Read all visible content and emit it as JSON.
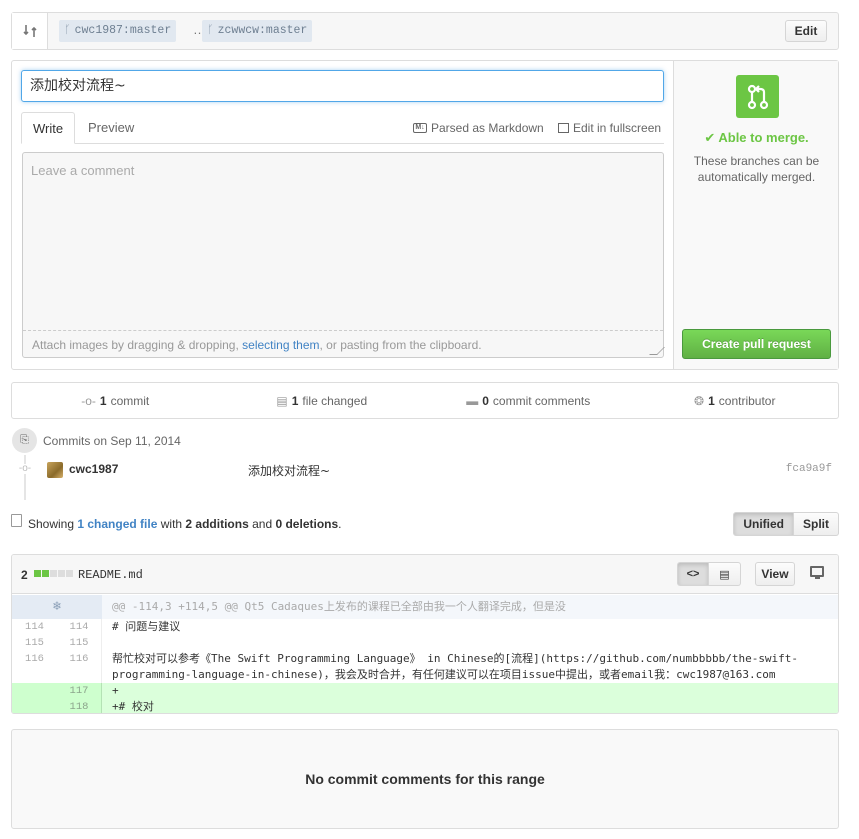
{
  "range": {
    "base": "cwc1987:master",
    "separator": "…",
    "head": "zcwwcw:master",
    "edit_label": "Edit"
  },
  "compose": {
    "title_value": "添加校对流程~",
    "tab_write": "Write",
    "tab_preview": "Preview",
    "parsed_markdown": "Parsed as Markdown",
    "edit_fullscreen": "Edit in fullscreen",
    "comment_placeholder": "Leave a comment",
    "attach_prefix": "Attach images by dragging & dropping, ",
    "attach_link": "selecting them",
    "attach_suffix": ", or pasting from the clipboard."
  },
  "merge": {
    "status": "Able to merge.",
    "description": "These branches can be automatically merged.",
    "create_label": "Create pull request",
    "accent": "#6cc644"
  },
  "numbers": {
    "commits_count": "1",
    "commits_label": "commit",
    "files_count": "1",
    "files_label": "file changed",
    "comments_count": "0",
    "comments_label": "commit comments",
    "contributors_count": "1",
    "contributors_label": "contributor"
  },
  "commits": {
    "date_label": "Commits on Sep 11, 2014",
    "items": [
      {
        "author": "cwc1987",
        "message": "添加校对流程~",
        "sha": "fca9a9f"
      }
    ]
  },
  "toc": {
    "prefix": "Showing ",
    "changed_link": "1 changed file",
    "with": " with ",
    "additions": "2 additions",
    "and": " and ",
    "deletions": "0 deletions",
    "period": ".",
    "unified_label": "Unified",
    "split_label": "Split"
  },
  "file": {
    "stat_count": "2",
    "name": "README.md",
    "view_label": "View",
    "code_toggle": "<>",
    "hunk_header": "@@ -114,3 +114,5 @@ Qt5 Cadaques上发布的课程已全部由我一个人翻译完成，但是没",
    "lines": [
      {
        "old": "114",
        "new": "114",
        "text": " # 问题与建议"
      },
      {
        "old": "115",
        "new": "115",
        "text": ""
      },
      {
        "old": "116",
        "new": "116",
        "text": " 帮忙校对可以参考《The Swift Programming Language》 in Chinese的[流程](https://github.com/numbbbbb/the-swift-",
        "text2": " programming-language-in-chinese)，我会及时合并，有任何建议可以在项目issue中提出，或者email我：cwc1987@163.com"
      },
      {
        "old": "",
        "new": "117",
        "text": "+"
      },
      {
        "old": "",
        "new": "118",
        "text": "+# 校对"
      }
    ]
  },
  "empty_comments": "No commit comments for this range"
}
